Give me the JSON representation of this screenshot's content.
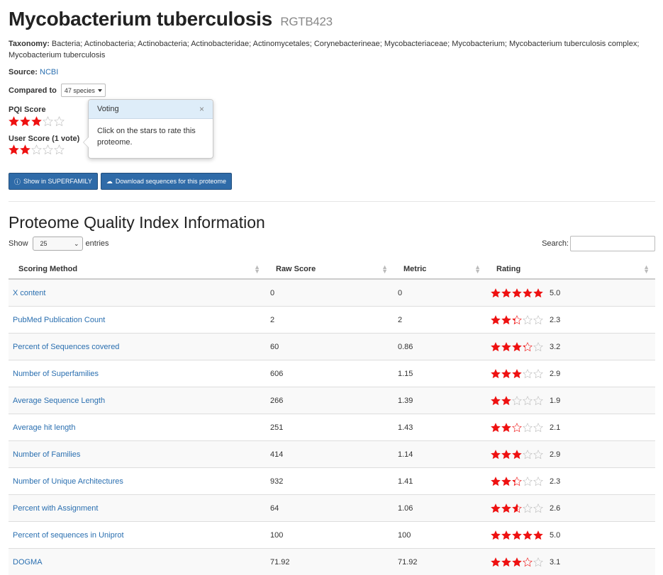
{
  "header": {
    "title": "Mycobacterium tuberculosis",
    "code": "RGTB423"
  },
  "taxonomy": {
    "label": "Taxonomy:",
    "value": "Bacteria; Actinobacteria; Actinobacteria; Actinobacteridae; Actinomycetales; Corynebacterineae; Mycobacteriaceae; Mycobacterium; Mycobacterium tuberculosis complex; Mycobacterium tuberculosis"
  },
  "source": {
    "label": "Source:",
    "link": "NCBI"
  },
  "compared": {
    "label": "Compared to",
    "selected": "47 species"
  },
  "pqi": {
    "label": "PQI Score",
    "rating": 3.0
  },
  "user_score": {
    "label": "User Score (1 vote)",
    "rating": 2.0
  },
  "popover": {
    "title": "Voting",
    "close": "×",
    "body": "Click on the stars to rate this proteome."
  },
  "buttons": {
    "superfamily": {
      "icon": "info-icon",
      "label": "Show in SUPERFAMILY"
    },
    "download": {
      "icon": "cloud-download-icon",
      "label": "Download sequences for this proteome"
    }
  },
  "section_title": "Proteome Quality Index Information",
  "table_controls": {
    "show_label": "Show",
    "entries_value": "25",
    "entries_label": "entries",
    "search_label": "Search:",
    "search_value": ""
  },
  "table": {
    "columns": [
      "Scoring Method",
      "Raw Score",
      "Metric",
      "Rating"
    ],
    "rows": [
      {
        "method": "X content",
        "raw": "0",
        "metric": "0",
        "rating": "5.0"
      },
      {
        "method": "PubMed Publication Count",
        "raw": "2",
        "metric": "2",
        "rating": "2.3"
      },
      {
        "method": "Percent of Sequences covered",
        "raw": "60",
        "metric": "0.86",
        "rating": "3.2"
      },
      {
        "method": "Number of Superfamilies",
        "raw": "606",
        "metric": "1.15",
        "rating": "2.9"
      },
      {
        "method": "Average Sequence Length",
        "raw": "266",
        "metric": "1.39",
        "rating": "1.9"
      },
      {
        "method": "Average hit length",
        "raw": "251",
        "metric": "1.43",
        "rating": "2.1"
      },
      {
        "method": "Number of Families",
        "raw": "414",
        "metric": "1.14",
        "rating": "2.9"
      },
      {
        "method": "Number of Unique Architectures",
        "raw": "932",
        "metric": "1.41",
        "rating": "2.3"
      },
      {
        "method": "Percent with Assignment",
        "raw": "64",
        "metric": "1.06",
        "rating": "2.6"
      },
      {
        "method": "Percent of sequences in Uniprot",
        "raw": "100",
        "metric": "100",
        "rating": "5.0"
      },
      {
        "method": "DOGMA",
        "raw": "71.92",
        "metric": "71.92",
        "rating": "3.1"
      }
    ]
  },
  "colors": {
    "star_fill": "#ee1111",
    "star_empty": "#bbbbbb",
    "link": "#2a6fb0",
    "button": "#2f6ba8",
    "popover_header": "#deedf9"
  }
}
